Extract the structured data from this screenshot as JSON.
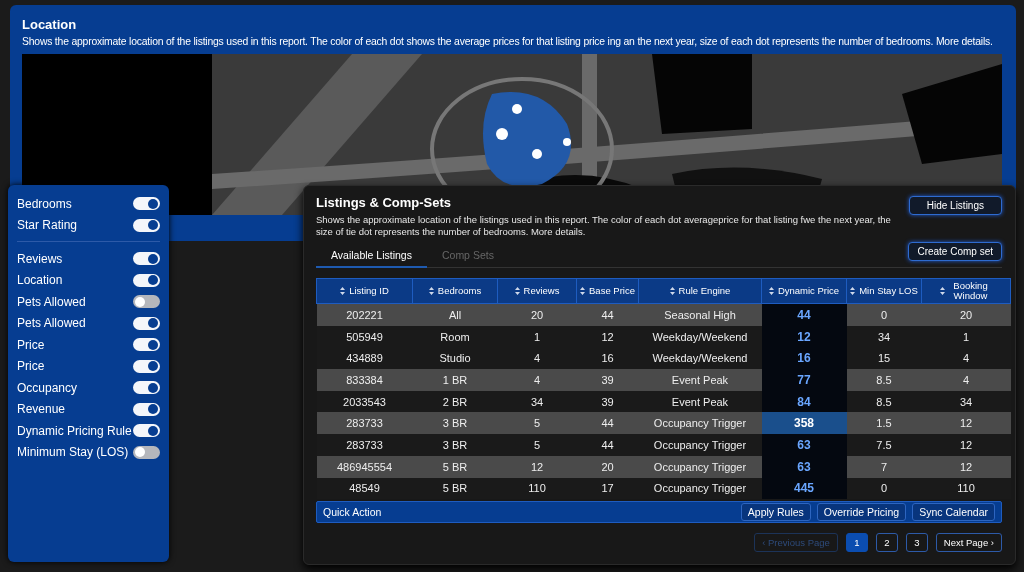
{
  "location": {
    "title": "Location",
    "description": "Shows the approximate location of the listings used in this report. The color of each dot shows the average prices for that listing price ing an the next year, size of each dot represents the number of bedrooms. More details."
  },
  "filter_groups": [
    [
      {
        "label": "Bedrooms",
        "on": true
      },
      {
        "label": "Star Rating",
        "on": true
      }
    ],
    [
      {
        "label": "Reviews",
        "on": true
      },
      {
        "label": "Location",
        "on": true
      },
      {
        "label": "Pets Allowed",
        "on": false
      },
      {
        "label": "Pets Allowed",
        "on": true
      },
      {
        "label": "Price",
        "on": true
      },
      {
        "label": "Price",
        "on": true
      },
      {
        "label": "Occupancy",
        "on": true
      },
      {
        "label": "Revenue",
        "on": true
      },
      {
        "label": "Dynamic Pricing Rule",
        "on": true
      },
      {
        "label": "Minimum Stay (LOS)",
        "on": false
      }
    ]
  ],
  "listings": {
    "title": "Listings & Comp-Sets",
    "description": "Shows the approximate location of the listings used in this report. The color of each dot averageprice for that listing fwe the next year, the size of tie dot represents the number of bedrooms. More details.",
    "hide_button": "Hide Listings",
    "create_button": "Create Comp set",
    "tabs": [
      {
        "label": "Available Listings",
        "selected": true
      },
      {
        "label": "Comp Sets",
        "selected": false
      }
    ],
    "table": {
      "columns": [
        "Listing ID",
        "Bedrooms",
        "Reviews",
        "Base Price",
        "Rule Engine",
        "Dynamic Price",
        "Min Stay LOS",
        "Booking Window"
      ],
      "rows": [
        {
          "cells": [
            "202221",
            "All",
            "20",
            "44",
            "Seasonal High",
            "44",
            "0",
            "20"
          ],
          "highlighted": true,
          "glow": false
        },
        {
          "cells": [
            "505949",
            "Room",
            "1",
            "12",
            "Weekday/Weekend",
            "12",
            "34",
            "1"
          ],
          "highlighted": false,
          "glow": false
        },
        {
          "cells": [
            "434889",
            "Studio",
            "4",
            "16",
            "Weekday/Weekend",
            "16",
            "15",
            "4"
          ],
          "highlighted": false,
          "glow": false
        },
        {
          "cells": [
            "833384",
            "1 BR",
            "4",
            "39",
            "Event Peak",
            "77",
            "8.5",
            "4"
          ],
          "highlighted": true,
          "glow": false
        },
        {
          "cells": [
            "2033543",
            "2 BR",
            "34",
            "39",
            "Event Peak",
            "84",
            "8.5",
            "34"
          ],
          "highlighted": false,
          "glow": false
        },
        {
          "cells": [
            "283733",
            "3 BR",
            "5",
            "44",
            "Occupancy Trigger",
            "358",
            "1.5",
            "12"
          ],
          "highlighted": true,
          "glow": true
        },
        {
          "cells": [
            "283733",
            "3 BR",
            "5",
            "44",
            "Occupancy Trigger",
            "63",
            "7.5",
            "12"
          ],
          "highlighted": false,
          "glow": false
        },
        {
          "cells": [
            "486945554",
            "5 BR",
            "12",
            "20",
            "Occupancy Trigger",
            "63",
            "7",
            "12"
          ],
          "highlighted": true,
          "glow": false
        },
        {
          "cells": [
            "48549",
            "5 BR",
            "110",
            "17",
            "Occupancy Trigger",
            "445",
            "0",
            "110"
          ],
          "highlighted": false,
          "glow": false
        }
      ]
    },
    "quick_action": {
      "label": "Quick Action",
      "buttons": [
        "Apply Rules",
        "Override Pricing",
        "Sync Calendar"
      ]
    },
    "pagination": [
      {
        "label": "‹ Previous Page",
        "kind": "prev",
        "selected": false,
        "disabled": true
      },
      {
        "label": "1",
        "kind": "page",
        "selected": true,
        "disabled": false
      },
      {
        "label": "2",
        "kind": "page",
        "selected": false,
        "disabled": false
      },
      {
        "label": "3",
        "kind": "page",
        "selected": false,
        "disabled": false
      },
      {
        "label": "Next Page ›",
        "kind": "next",
        "selected": false,
        "disabled": false
      }
    ]
  }
}
